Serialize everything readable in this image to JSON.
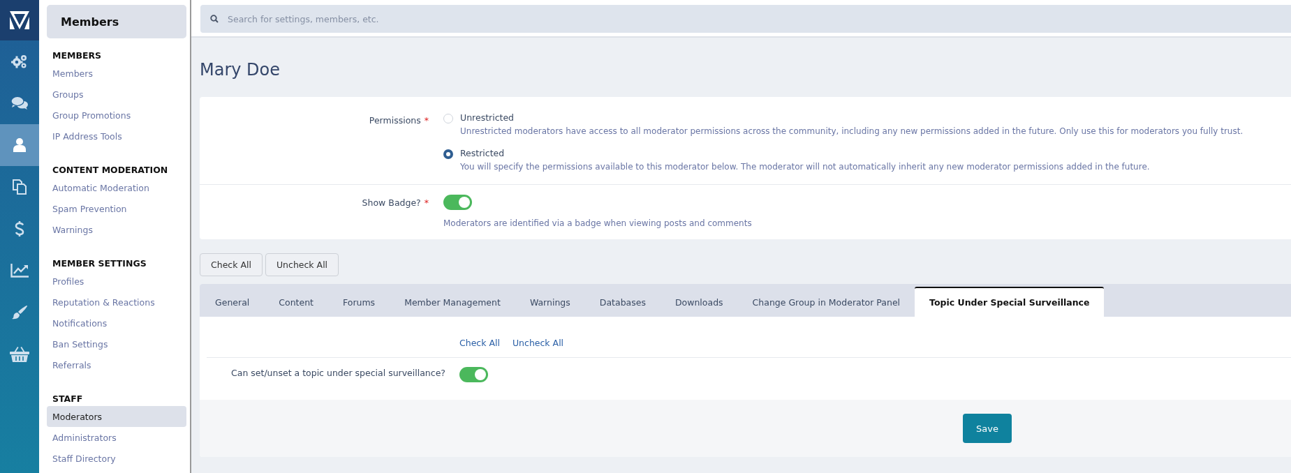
{
  "rail": {
    "items": [
      {
        "kind": "logo",
        "selected": false
      },
      {
        "kind": "gears",
        "selected": false
      },
      {
        "kind": "chat",
        "selected": false
      },
      {
        "kind": "user",
        "selected": true
      },
      {
        "kind": "copies",
        "selected": false
      },
      {
        "kind": "dollar",
        "selected": false
      },
      {
        "kind": "chart",
        "selected": false
      },
      {
        "kind": "brush",
        "selected": false
      },
      {
        "kind": "basket",
        "selected": false
      }
    ]
  },
  "sidebar": {
    "title": "Members",
    "sections": [
      {
        "heading": "MEMBERS",
        "items": [
          {
            "label": "Members",
            "selected": false
          },
          {
            "label": "Groups",
            "selected": false
          },
          {
            "label": "Group Promotions",
            "selected": false
          },
          {
            "label": "IP Address Tools",
            "selected": false
          }
        ]
      },
      {
        "heading": "CONTENT MODERATION",
        "items": [
          {
            "label": "Automatic Moderation",
            "selected": false
          },
          {
            "label": "Spam Prevention",
            "selected": false
          },
          {
            "label": "Warnings",
            "selected": false
          }
        ]
      },
      {
        "heading": "MEMBER SETTINGS",
        "items": [
          {
            "label": "Profiles",
            "selected": false
          },
          {
            "label": "Reputation & Reactions",
            "selected": false
          },
          {
            "label": "Notifications",
            "selected": false
          },
          {
            "label": "Ban Settings",
            "selected": false
          },
          {
            "label": "Referrals",
            "selected": false
          }
        ]
      },
      {
        "heading": "STAFF",
        "items": [
          {
            "label": "Moderators",
            "selected": true
          },
          {
            "label": "Administrators",
            "selected": false
          },
          {
            "label": "Staff Directory",
            "selected": false
          }
        ]
      }
    ]
  },
  "search": {
    "placeholder": "Search for settings, members, etc."
  },
  "page_title": "Mary Doe",
  "form": {
    "fields": [
      {
        "kind": "radio",
        "label": "Permissions",
        "required_mark": "*",
        "options": [
          {
            "label": "Unrestricted",
            "description": "Unrestricted moderators have access to all moderator permissions across the community, including any new permissions added in the future. Only use this for moderators you fully trust.",
            "selected": false
          },
          {
            "label": "Restricted",
            "description": "You will specify the permissions available to this moderator below. The moderator will not automatically inherit any new moderator permissions added in the future.",
            "selected": true
          }
        ]
      },
      {
        "kind": "toggle",
        "label": "Show Badge?",
        "required_mark": "*",
        "on": true,
        "description": "Moderators are identified via a badge when viewing posts and comments"
      }
    ]
  },
  "bulk_buttons": [
    "Check All",
    "Uncheck All"
  ],
  "tabs": [
    {
      "label": "General",
      "selected": false
    },
    {
      "label": "Content",
      "selected": false
    },
    {
      "label": "Forums",
      "selected": false
    },
    {
      "label": "Member Management",
      "selected": false
    },
    {
      "label": "Warnings",
      "selected": false
    },
    {
      "label": "Databases",
      "selected": false
    },
    {
      "label": "Downloads",
      "selected": false
    },
    {
      "label": "Change Group in Moderator Panel",
      "selected": false
    },
    {
      "label": "Topic Under Special Surveillance",
      "selected": true
    }
  ],
  "tab_panel": {
    "links": [
      "Check All",
      "Uncheck All"
    ],
    "rows": [
      {
        "label": "Can set/unset a topic under special surveillance?",
        "on": true
      }
    ]
  },
  "save_button": "Save"
}
